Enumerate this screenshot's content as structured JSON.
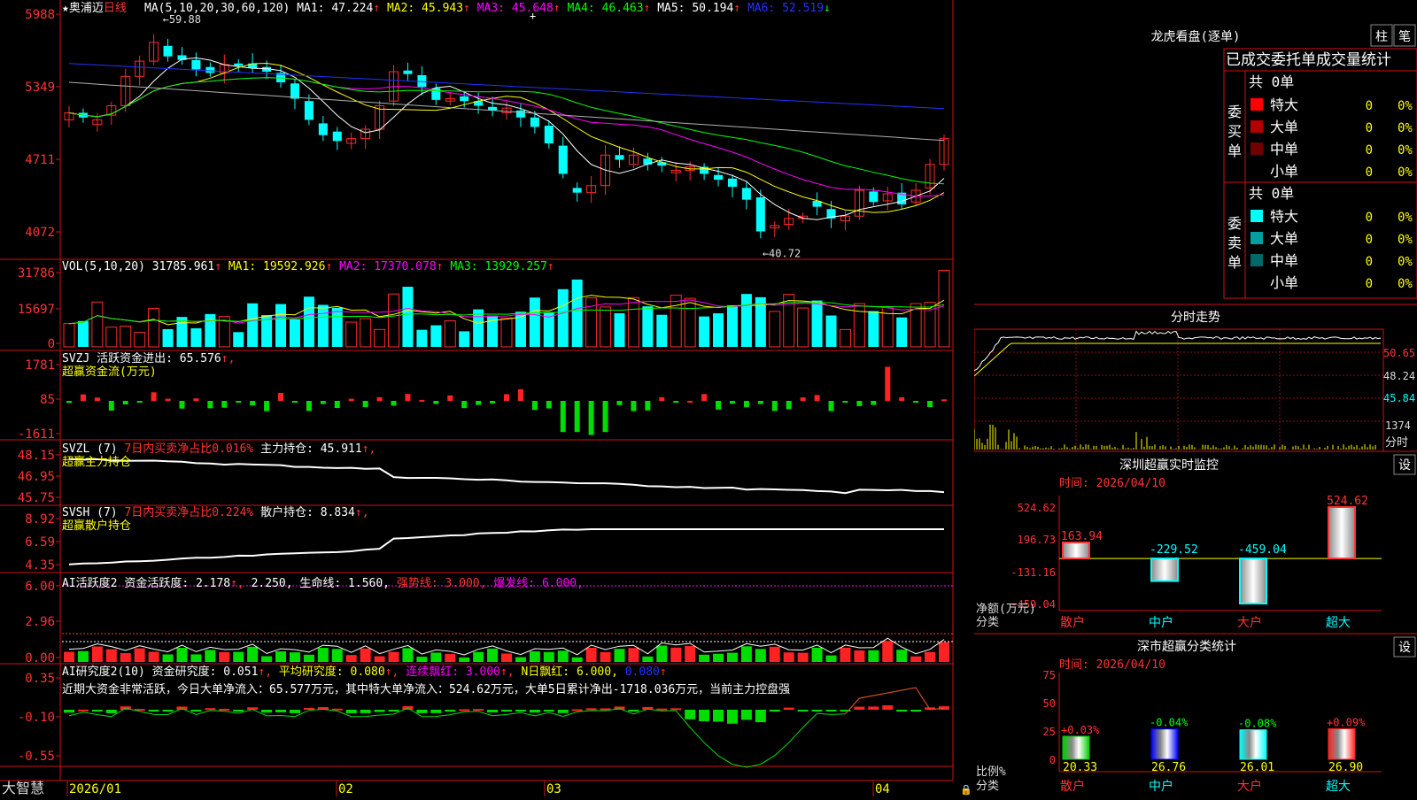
{
  "stock": {
    "name": "奥浦迈",
    "star": "★",
    "period": "日线"
  },
  "colors": {
    "up": "#ff2a2a",
    "down": "#00ffff",
    "axis": "#d01010",
    "ma1": "#ffffff",
    "ma2": "#ffff00",
    "ma3": "#ff00ff",
    "ma4": "#00ff00",
    "ma5": "#b0b0b0",
    "ma6": "#2233ff"
  },
  "panels": {
    "price": {
      "axis": [
        "5988",
        "5349",
        "4711",
        "4072"
      ],
      "legend": [
        {
          "text": "MA(5,10,20,30,60,120)",
          "color": "#ffffff"
        },
        {
          "text": "MA1: 47.224",
          "arrow": "↑",
          "color": "#ffffff"
        },
        {
          "text": "MA2: 45.943",
          "arrow": "↑",
          "color": "#ffff00"
        },
        {
          "text": "MA3: 45.648",
          "arrow": "↑",
          "color": "#ff00ff"
        },
        {
          "text": "MA4: 46.463",
          "arrow": "↑",
          "color": "#00ff00"
        },
        {
          "text": "MA5: 50.194",
          "arrow": "↑",
          "color": "#ffffff"
        },
        {
          "text": "MA6: 52.519",
          "arrow": "↓",
          "color": "#2233ff"
        }
      ],
      "high_mark": "59.88",
      "low_mark": "40.72"
    },
    "vol": {
      "axis": [
        "31786",
        "15697",
        "0"
      ],
      "legend": [
        {
          "text": "VOL(5,10,20)",
          "color": "#ffffff"
        },
        {
          "text": "31785.961",
          "arrow": "↑",
          "color": "#ffffff"
        },
        {
          "text": "MA1: 19592.926",
          "arrow": "↑",
          "color": "#ffff00"
        },
        {
          "text": "MA2: 17370.078",
          "arrow": "↑",
          "color": "#ff00ff"
        },
        {
          "text": "MA3: 13929.257",
          "arrow": "↑",
          "color": "#00ff00"
        }
      ]
    },
    "svzj": {
      "axis": [
        "1781",
        "85",
        "-1611"
      ],
      "legend": [
        {
          "text": "SVZJ  活跃资金进出: 65.576",
          "arrow": "↑,",
          "color": "#ffffff"
        }
      ],
      "legend2": "超赢资金流(万元)"
    },
    "svzl": {
      "axis": [
        "48.15",
        "46.95",
        "45.75"
      ],
      "legend": [
        {
          "text": "SVZL (7)",
          "color": "#ffffff"
        },
        {
          "text": "7日内买卖净占比0.016%",
          "color": "#ff3333"
        },
        {
          "text": "主力持仓: 45.911",
          "arrow": "↑,",
          "color": "#ffffff"
        }
      ],
      "legend2": "超赢主力持仓"
    },
    "svsh": {
      "axis": [
        "8.92",
        "6.59",
        "4.35"
      ],
      "legend": [
        {
          "text": "SVSH (7)",
          "color": "#ffffff"
        },
        {
          "text": "7日内买卖净占比0.224%",
          "color": "#ff3333"
        },
        {
          "text": "散户持仓: 8.834",
          "arrow": "↑,",
          "color": "#ffffff"
        }
      ],
      "legend2": "超赢散户持仓"
    },
    "ai1": {
      "axis": [
        "6.00",
        "2.96",
        "0.00"
      ],
      "legend": [
        {
          "text": "AI活跃度2",
          "color": "#ffffff"
        },
        {
          "text": "资金活跃度: 2.178",
          "arrow": "↑,",
          "color": "#ffffff"
        },
        {
          "text": "2.250,",
          "color": "#ffffff"
        },
        {
          "text": "生命线: 1.560,",
          "color": "#ffffff"
        },
        {
          "text": "强势线: 3.000,",
          "color": "#ff3333"
        },
        {
          "text": "爆发线: 6.000,",
          "color": "#ff00ff"
        }
      ]
    },
    "ai2": {
      "axis": [
        "0.35",
        "-0.10",
        "-0.55"
      ],
      "legend": [
        {
          "text": "AI研究度2(10)",
          "color": "#ffffff"
        },
        {
          "text": "资金研究度: 0.051",
          "arrow": "↑,",
          "color": "#ffffff"
        },
        {
          "text": "平均研究度: 0.080",
          "arrow": "↑,",
          "color": "#ffff00"
        },
        {
          "text": "连续飘红: 3.000",
          "arrow": "↑,",
          "color": "#ff00ff"
        },
        {
          "text": "N日飘红: 6.000,",
          "color": "#ffff00"
        },
        {
          "text": "0.080",
          "arrow": "↑",
          "color": "#2233ff"
        }
      ],
      "summary": "近期大资金非常活跃，今日大单净流入：65.577万元，其中特大单净流入：524.62万元，大单5日累计净出-1718.036万元，当前主力控盘强"
    }
  },
  "dates": [
    "2026/01",
    "02",
    "03",
    "04"
  ],
  "brand": "大智慧",
  "right": {
    "lhb_title": "龙虎看盘(逐单)",
    "btn_bar": "柱",
    "btn_tick": "笔",
    "stats_title": "已成交委托单成交量统计",
    "buy": {
      "side": "委买单",
      "total": "共 0单",
      "rows": [
        {
          "label": "特大",
          "count": "0",
          "pct": "0%",
          "color": "#ff0000"
        },
        {
          "label": "大单",
          "count": "0",
          "pct": "0%",
          "color": "#b00000"
        },
        {
          "label": "中单",
          "count": "0",
          "pct": "0%",
          "color": "#700000"
        },
        {
          "label": "小单",
          "count": "0",
          "pct": "0%",
          "color": ""
        }
      ]
    },
    "sell": {
      "side": "委卖单",
      "total": "共 0单",
      "rows": [
        {
          "label": "特大",
          "count": "0",
          "pct": "0%",
          "color": "#00ffff"
        },
        {
          "label": "大单",
          "count": "0",
          "pct": "0%",
          "color": "#00a0a0"
        },
        {
          "label": "中单",
          "count": "0",
          "pct": "0%",
          "color": "#006868"
        },
        {
          "label": "小单",
          "count": "0",
          "pct": "0%",
          "color": ""
        }
      ]
    },
    "intraday": {
      "title": "分时走势",
      "axis": [
        "50.65",
        "48.24",
        "45.84"
      ],
      "vol_axis": "1374",
      "vol_label": "分时"
    },
    "monitor": {
      "title": "深圳超赢实时监控",
      "btn": "设",
      "time": "时间: 2026/04/10",
      "axis": [
        "524.62",
        "196.73",
        "-131.16",
        "-459.04"
      ],
      "ylabel1": "净额(万元)",
      "ylabel2": "分类",
      "bars": [
        {
          "label": "散户",
          "value": 163.94,
          "text": "163.94",
          "color": "#ff3333"
        },
        {
          "label": "中户",
          "value": -229.52,
          "text": "-229.52",
          "color": "#00ffff"
        },
        {
          "label": "大户",
          "value": -459.04,
          "text": "-459.04",
          "color": "#00ffff"
        },
        {
          "label": "超大",
          "value": 524.62,
          "text": "524.62",
          "color": "#ff3333"
        }
      ]
    },
    "classify": {
      "title": "深市超赢分类统计",
      "btn": "设",
      "time": "时间: 2026/04/10",
      "axis": [
        "75",
        "50",
        "25",
        "0"
      ],
      "ylabel1": "比例%",
      "ylabel2": "分类",
      "bars": [
        {
          "label": "散户",
          "value": 20.33,
          "text": "20.33",
          "delta": "+0.03%",
          "delta_color": "#ff3333",
          "fill": "#00cc00"
        },
        {
          "label": "中户",
          "value": 26.76,
          "text": "26.76",
          "delta": "-0.04%",
          "delta_color": "#00ff00",
          "fill": "#0000ff"
        },
        {
          "label": "大户",
          "value": 26.01,
          "text": "26.01",
          "delta": "-0.08%",
          "delta_color": "#00ff00",
          "fill": "#00ffff"
        },
        {
          "label": "超大",
          "value": 26.9,
          "text": "26.90",
          "delta": "+0.09%",
          "delta_color": "#ff3333",
          "fill": "#ff2222"
        }
      ]
    }
  }
}
